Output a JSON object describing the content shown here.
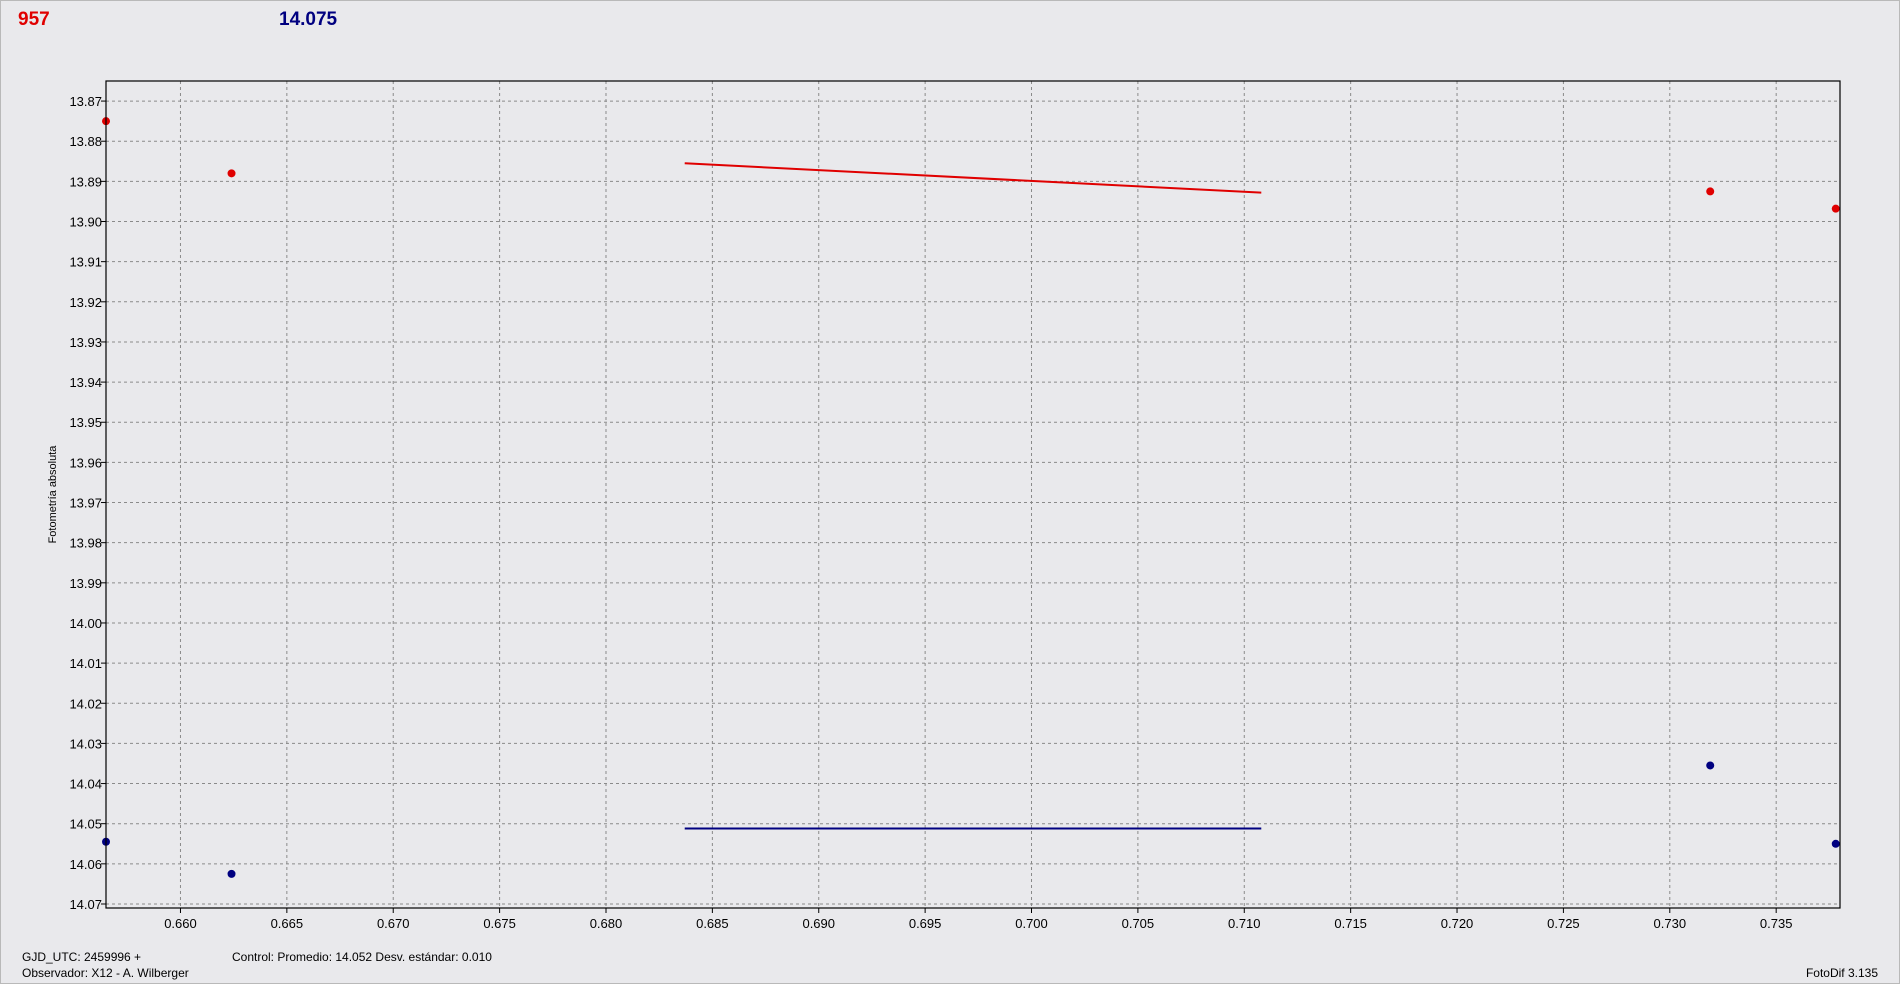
{
  "header": {
    "target_value": "957",
    "control_value": "14.075"
  },
  "footer": {
    "gjd": "GJD_UTC: 2459996 +",
    "control_stats": "Control: Promedio: 14.052   Desv. estándar: 0.010",
    "observer": "Observador: X12 - A. Wilberger",
    "version": "FotoDif 3.135"
  },
  "colors": {
    "target": "#e00000",
    "control": "#000080",
    "grid": "#8a8a8a",
    "plot_bg": "#e9e9ec"
  },
  "chart_data": {
    "type": "scatter",
    "title": "",
    "xlabel": "",
    "ylabel": "Fotometría absoluta",
    "xlim": [
      0.6565,
      0.738
    ],
    "ylim": [
      13.865,
      14.071
    ],
    "y_inverted": true,
    "grid": true,
    "x_ticks": [
      0.66,
      0.665,
      0.67,
      0.675,
      0.68,
      0.685,
      0.69,
      0.695,
      0.7,
      0.705,
      0.71,
      0.715,
      0.72,
      0.725,
      0.73,
      0.735
    ],
    "y_ticks": [
      13.87,
      13.88,
      13.89,
      13.9,
      13.91,
      13.92,
      13.93,
      13.94,
      13.95,
      13.96,
      13.97,
      13.98,
      13.99,
      14.0,
      14.01,
      14.02,
      14.03,
      14.04,
      14.05,
      14.06,
      14.07
    ],
    "series": [
      {
        "color": "#e00000",
        "points": [
          {
            "x": 0.6565,
            "y": 13.875
          },
          {
            "x": 0.6624,
            "y": 13.888
          },
          {
            "x": 0.7319,
            "y": 13.8925
          },
          {
            "x": 0.7378,
            "y": 13.8968
          }
        ],
        "fit": {
          "x": [
            0.6837,
            0.7108
          ],
          "y": [
            13.8855,
            13.8928
          ]
        }
      },
      {
        "color": "#000080",
        "points": [
          {
            "x": 0.6565,
            "y": 14.0545
          },
          {
            "x": 0.6624,
            "y": 14.0625
          },
          {
            "x": 0.7319,
            "y": 14.0355
          },
          {
            "x": 0.7378,
            "y": 14.055
          }
        ],
        "fit": {
          "x": [
            0.6837,
            0.7108
          ],
          "y": [
            14.0512,
            14.0512
          ]
        }
      }
    ]
  }
}
